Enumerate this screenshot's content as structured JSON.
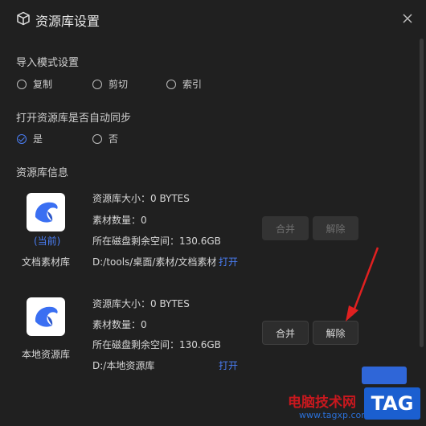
{
  "window": {
    "title": "资源库设置"
  },
  "import_mode": {
    "title": "导入模式设置",
    "options": [
      {
        "label": "复制",
        "checked": false
      },
      {
        "label": "剪切",
        "checked": false
      },
      {
        "label": "索引",
        "checked": false
      }
    ]
  },
  "auto_sync": {
    "title": "打开资源库是否自动同步",
    "options": [
      {
        "label": "是",
        "checked": true
      },
      {
        "label": "否",
        "checked": false
      }
    ]
  },
  "library_info": {
    "title": "资源库信息",
    "libraries": [
      {
        "current_tag": "(当前)",
        "name": "文档素材库",
        "size": "资源库大小：0 BYTES",
        "count": "素材数量：0",
        "free_space": "所在磁盘剩余空间：130.6GB",
        "path": "D:/tools/桌面/素材/文档素材",
        "open_label": "打开",
        "merge_label": "合并",
        "remove_label": "解除",
        "buttons_enabled": false
      },
      {
        "name": "本地资源库",
        "size": "资源库大小：0 BYTES",
        "count": "素材数量：0",
        "free_space": "所在磁盘剩余空间：130.6GB",
        "path": "D:/本地资源库",
        "open_label": "打开",
        "merge_label": "合并",
        "remove_label": "解除",
        "buttons_enabled": true
      }
    ]
  },
  "watermark": {
    "text": "电脑技术网",
    "url": "www.tagxp.com",
    "tag": "TAG"
  },
  "colors": {
    "accent": "#4a7ef5",
    "background": "#202020",
    "annotation_arrow": "#e02020"
  }
}
